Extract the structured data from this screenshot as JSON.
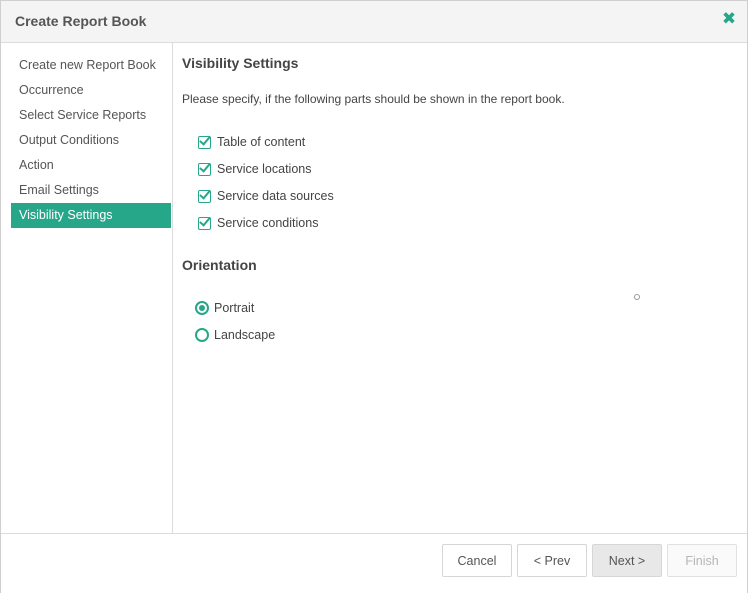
{
  "dialog": {
    "title": "Create Report Book",
    "close_icon": "close-x-icon",
    "accent_color": "#27a789"
  },
  "sidebar": {
    "items": [
      {
        "label": "Create new Report Book",
        "active": false
      },
      {
        "label": "Occurrence",
        "active": false
      },
      {
        "label": "Select Service Reports",
        "active": false
      },
      {
        "label": "Output Conditions",
        "active": false
      },
      {
        "label": "Action",
        "active": false
      },
      {
        "label": "Email Settings",
        "active": false
      },
      {
        "label": "Visibility Settings",
        "active": true
      }
    ]
  },
  "main": {
    "heading": "Visibility Settings",
    "description": "Please specify, if the following parts should be shown in the report book.",
    "options": [
      {
        "label": "Table of content",
        "checked": true
      },
      {
        "label": "Service locations",
        "checked": true
      },
      {
        "label": "Service data sources",
        "checked": true
      },
      {
        "label": "Service conditions",
        "checked": true
      }
    ],
    "orientation": {
      "heading": "Orientation",
      "choices": [
        {
          "label": "Portrait",
          "selected": true
        },
        {
          "label": "Landscape",
          "selected": false
        }
      ]
    }
  },
  "footer": {
    "cancel_label": "Cancel",
    "prev_label": "< Prev",
    "next_label": "Next >",
    "finish_label": "Finish",
    "finish_disabled": true
  }
}
